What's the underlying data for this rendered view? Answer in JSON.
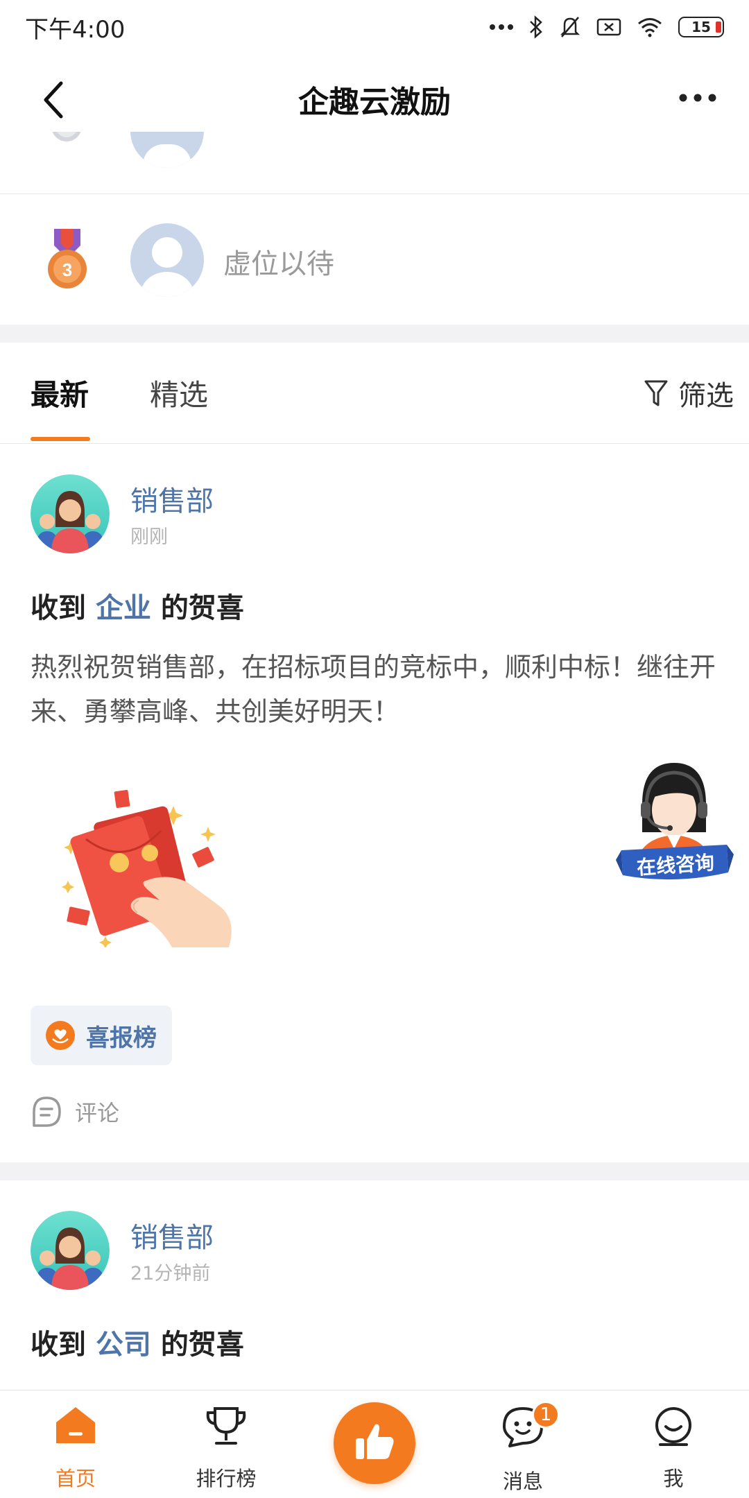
{
  "status_bar": {
    "time": "下午4:00",
    "battery": "15"
  },
  "nav": {
    "title": "企趣云激励"
  },
  "ranking": {
    "third_place_name": "虚位以待",
    "third_place_medal_number": "3"
  },
  "feed_tabs": {
    "latest": "最新",
    "featured": "精选",
    "filter": "筛选"
  },
  "posts": [
    {
      "department": "销售部",
      "time": "刚刚",
      "title_prefix": "收到",
      "title_sender": "企业",
      "title_suffix": "的贺喜",
      "body": "热烈祝贺销售部，在招标项目的竞标中，顺利中标！继往开来、勇攀高峰、共创美好明天！",
      "badge": "喜报榜",
      "comment": "评论"
    },
    {
      "department": "销售部",
      "time": "21分钟前",
      "title_prefix": "收到",
      "title_sender": "公司",
      "title_suffix": "的贺喜"
    }
  ],
  "floating_consult": {
    "label": "在线咨询"
  },
  "tabbar": {
    "items": [
      {
        "label": "首页",
        "icon": "home-icon"
      },
      {
        "label": "排行榜",
        "icon": "trophy-icon"
      },
      {
        "label": "",
        "icon": "thumbs-up-icon"
      },
      {
        "label": "消息",
        "icon": "message-icon"
      },
      {
        "label": "我",
        "icon": "profile-icon"
      }
    ],
    "unread_count": "1"
  },
  "colors": {
    "accent": "#f47a20",
    "link_blue": "#4e74a8"
  }
}
